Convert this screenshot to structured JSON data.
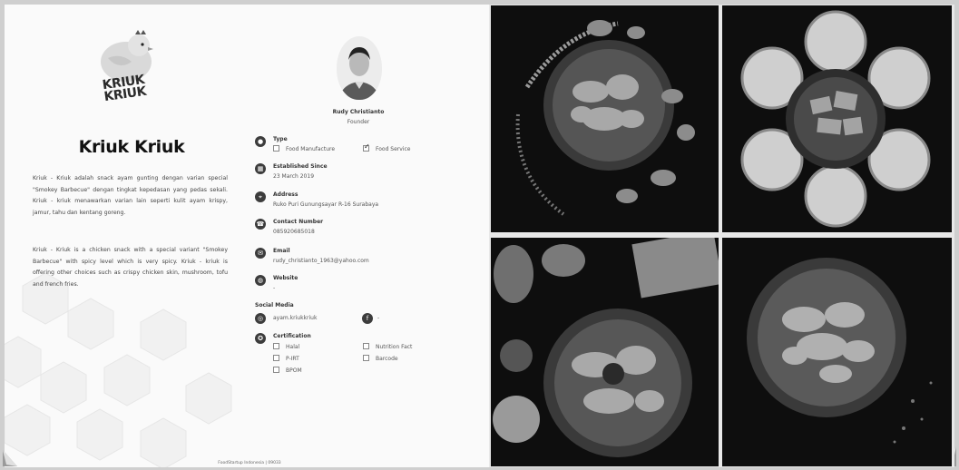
{
  "brand": {
    "logo_text_line1": "KRIUK",
    "logo_text_line2": "KRIUK",
    "name": "Kriuk Kriuk"
  },
  "description": {
    "indonesian": "Kriuk - Kriuk adalah snack ayam gunting dengan varian special \"Smokey Barbecue\" dengan tingkat kepedasan yang pedas sekali. Kriuk - kriuk menawarkan varian lain seperti kulit ayam krispy, jamur, tahu dan kentang goreng.",
    "english": "Kriuk - Kriuk is a chicken snack with a special variant \"Smokey Barbecue\" with spicy level which is very spicy. Kriuk - kriuk is offering other choices such as crispy chicken skin, mushroom, tofu and french fries."
  },
  "founder": {
    "name": "Rudy Christianto",
    "role": "Founder"
  },
  "type": {
    "label": "Type",
    "options": [
      {
        "label": "Food Manufacture",
        "checked": false
      },
      {
        "label": "Food Service",
        "checked": true
      }
    ]
  },
  "established": {
    "label": "Established Since",
    "value": "23 March 2019"
  },
  "address": {
    "label": "Address",
    "value": "Ruko Puri Gunungsayar R-16 Surabaya"
  },
  "contact": {
    "label": "Contact Number",
    "value": "085920685018"
  },
  "email": {
    "label": "Email",
    "value": "rudy_christianto_1963@yahoo.com"
  },
  "website": {
    "label": "Website",
    "value": "-"
  },
  "social": {
    "label": "Social Media",
    "instagram": "ayam.kriukkriuk",
    "facebook": "-"
  },
  "certification": {
    "label": "Certification",
    "options": [
      {
        "label": "Halal",
        "checked": false
      },
      {
        "label": "Nutrition Fact",
        "checked": false
      },
      {
        "label": "P-IRT",
        "checked": false
      },
      {
        "label": "Barcode",
        "checked": false
      },
      {
        "label": "BPOM",
        "checked": false
      }
    ]
  },
  "footer": {
    "text": "FoodStartup Indonesia | 09033"
  },
  "icons": {
    "type": "tag-icon",
    "established": "calendar-icon",
    "address": "location-icon",
    "contact": "phone-icon",
    "email": "mail-icon",
    "website": "globe-icon",
    "instagram": "instagram-icon",
    "facebook": "facebook-icon",
    "certification": "certificate-icon"
  }
}
